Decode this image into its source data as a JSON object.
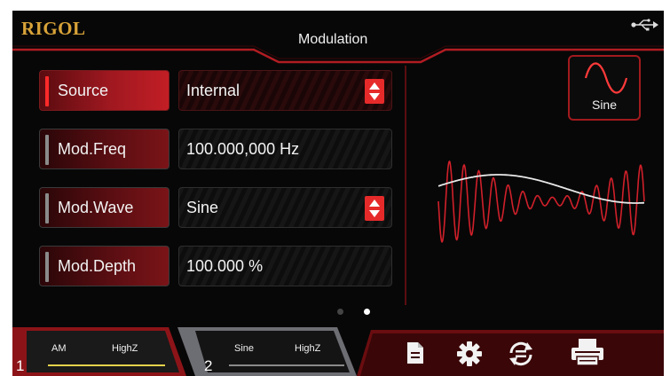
{
  "header": {
    "logo": "RIGOL",
    "title": "Modulation",
    "usb_icon": "usb-icon"
  },
  "params": [
    {
      "label": "Source",
      "value": "Internal",
      "active": true,
      "has_dropdown": true
    },
    {
      "label": "Mod.Freq",
      "value": "100.000,000 Hz",
      "active": false,
      "has_dropdown": false
    },
    {
      "label": "Mod.Wave",
      "value": "Sine",
      "active": false,
      "has_dropdown": true
    },
    {
      "label": "Mod.Depth",
      "value": "100.000 %",
      "active": false,
      "has_dropdown": false
    }
  ],
  "wave_preview": {
    "label": "Sine",
    "icon": "sine-wave-icon"
  },
  "pages": {
    "count": 2,
    "current": 2
  },
  "channels": [
    {
      "number": "1",
      "wave": "AM",
      "impedance": "HighZ",
      "active": true,
      "line_color": "#e4d24a"
    },
    {
      "number": "2",
      "wave": "Sine",
      "impedance": "HighZ",
      "active": false,
      "line_color": "#8a8a8a"
    }
  ],
  "toolbar": [
    "file-icon",
    "gear-icon",
    "sync-icon",
    "print-icon"
  ],
  "colors": {
    "accent": "#c21e25",
    "logo": "#d8a338",
    "background": "#070707",
    "ch1_line": "#e4d24a"
  }
}
